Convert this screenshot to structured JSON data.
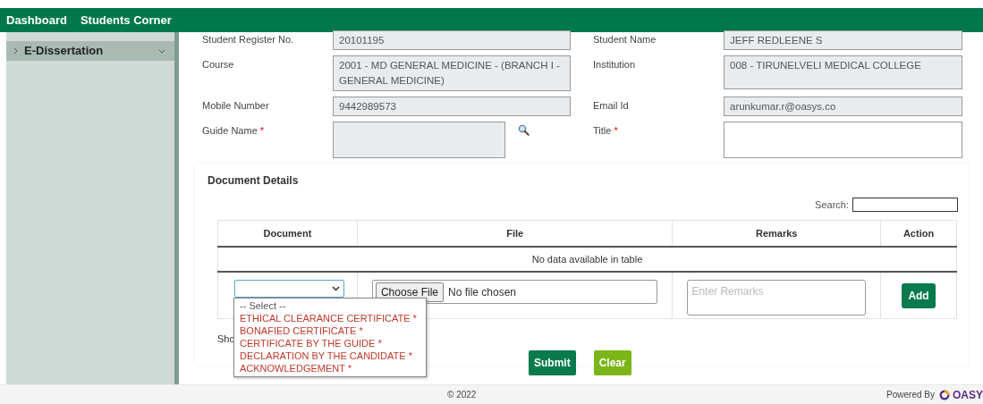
{
  "navbar": {
    "items": [
      {
        "label": "Dashboard"
      },
      {
        "label": "Students Corner"
      }
    ]
  },
  "sidebar": {
    "items": [
      {
        "label": "E-Dissertation",
        "expanded": false
      }
    ]
  },
  "form": {
    "fields": [
      {
        "label": "Student Register No.",
        "value": "20101195",
        "kind": "input"
      },
      {
        "label": "Student Name",
        "value": "JEFF REDLEENE S",
        "kind": "input"
      },
      {
        "label": "Course",
        "value": "2001 - MD GENERAL MEDICINE - (BRANCH I - GENERAL MEDICINE)",
        "kind": "textarea"
      },
      {
        "label": "Institution",
        "value": "008 - TIRUNELVELI MEDICAL COLLEGE",
        "kind": "textarea"
      },
      {
        "label": "Mobile Number",
        "value": "9442989573",
        "kind": "input"
      },
      {
        "label": "Email Id",
        "value": "arunkumar.r@oasys.co",
        "kind": "input"
      },
      {
        "label": "Guide Name",
        "required_mark": "*",
        "kind": "lookup"
      },
      {
        "label": "Title",
        "required_mark": "*",
        "kind": "editable"
      }
    ]
  },
  "documents": {
    "title": "Document Details",
    "search_label": "Search:",
    "columns": [
      "Document",
      "File",
      "Remarks",
      "Action"
    ],
    "empty_message": "No data available in table",
    "entry_row": {
      "select_open": true,
      "options": [
        {
          "label": "-- Select --",
          "kind": "placeholder"
        },
        {
          "label": "ETHICAL CLEARANCE CERTIFICATE *",
          "kind": "required"
        },
        {
          "label": "BONAFIED CERTIFICATE *",
          "kind": "required"
        },
        {
          "label": "CERTIFICATE BY THE GUIDE *",
          "kind": "required"
        },
        {
          "label": "DECLARATION BY THE CANDIDATE *",
          "kind": "required"
        },
        {
          "label": "ACKNOWLEDGEMENT *",
          "kind": "required"
        }
      ],
      "file_button": "Choose File",
      "file_status": "No file chosen",
      "remarks_placeholder": "Enter Remarks",
      "add_button": "Add"
    },
    "info": "Sho"
  },
  "buttons": [
    {
      "label": "Submit",
      "kind": "primary"
    },
    {
      "label": "Clear",
      "kind": "secondary"
    }
  ],
  "footer": {
    "copyright": "© 2022",
    "powered_by": "Powered By",
    "brand": "OASY"
  }
}
